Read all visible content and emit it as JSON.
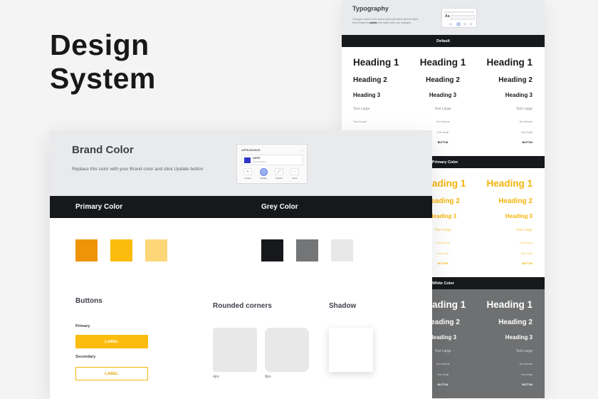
{
  "hero": {
    "line1": "Design",
    "line2": "System"
  },
  "typography": {
    "title": "Typography",
    "desc_pre": "Changes made to the styles below will affect all text styles. Don't forget to ",
    "desc_bold": "update",
    "desc_post": " text styles after you changes.",
    "mini_card_label": "Aa",
    "sections": [
      {
        "band": "Default",
        "style": "dark"
      },
      {
        "band": "Primary Color",
        "style": "gold"
      },
      {
        "band": "White Color",
        "style": "light"
      }
    ],
    "styles": {
      "h1": "Heading 1",
      "h2": "Heading 2",
      "h3": "Heading 3",
      "text_large": "Text Large",
      "text_normal": "Text Normal",
      "text_small": "Text Small",
      "button": "BUTTON"
    }
  },
  "brand": {
    "title": "Brand Color",
    "description": "Replace this color with your Brand color and click Update button",
    "appearance": {
      "label": "APPEARANCE",
      "hex": "#2F37",
      "sub": "Ink / Primary 1",
      "buttons": [
        "Create",
        "Update",
        "Detach",
        "More"
      ]
    },
    "primary_label": "Primary Color",
    "grey_label": "Grey Color",
    "primary_swatches": [
      "#ef9307",
      "#fbbc0e",
      "#fdd679"
    ],
    "grey_swatches": [
      "#16181b",
      "#747577",
      "#e8e8e9"
    ],
    "buttons_title": "Buttons",
    "primary_btn_label": "Primary",
    "secondary_btn_label": "Secondary",
    "btn_text": "LABEL",
    "rounded_title": "Rounded corners",
    "corner_caps": [
      "4px",
      "8px"
    ],
    "shadow_title": "Shadow"
  },
  "colors": {
    "accent": "#fbbc0e",
    "dark": "#16181b"
  }
}
